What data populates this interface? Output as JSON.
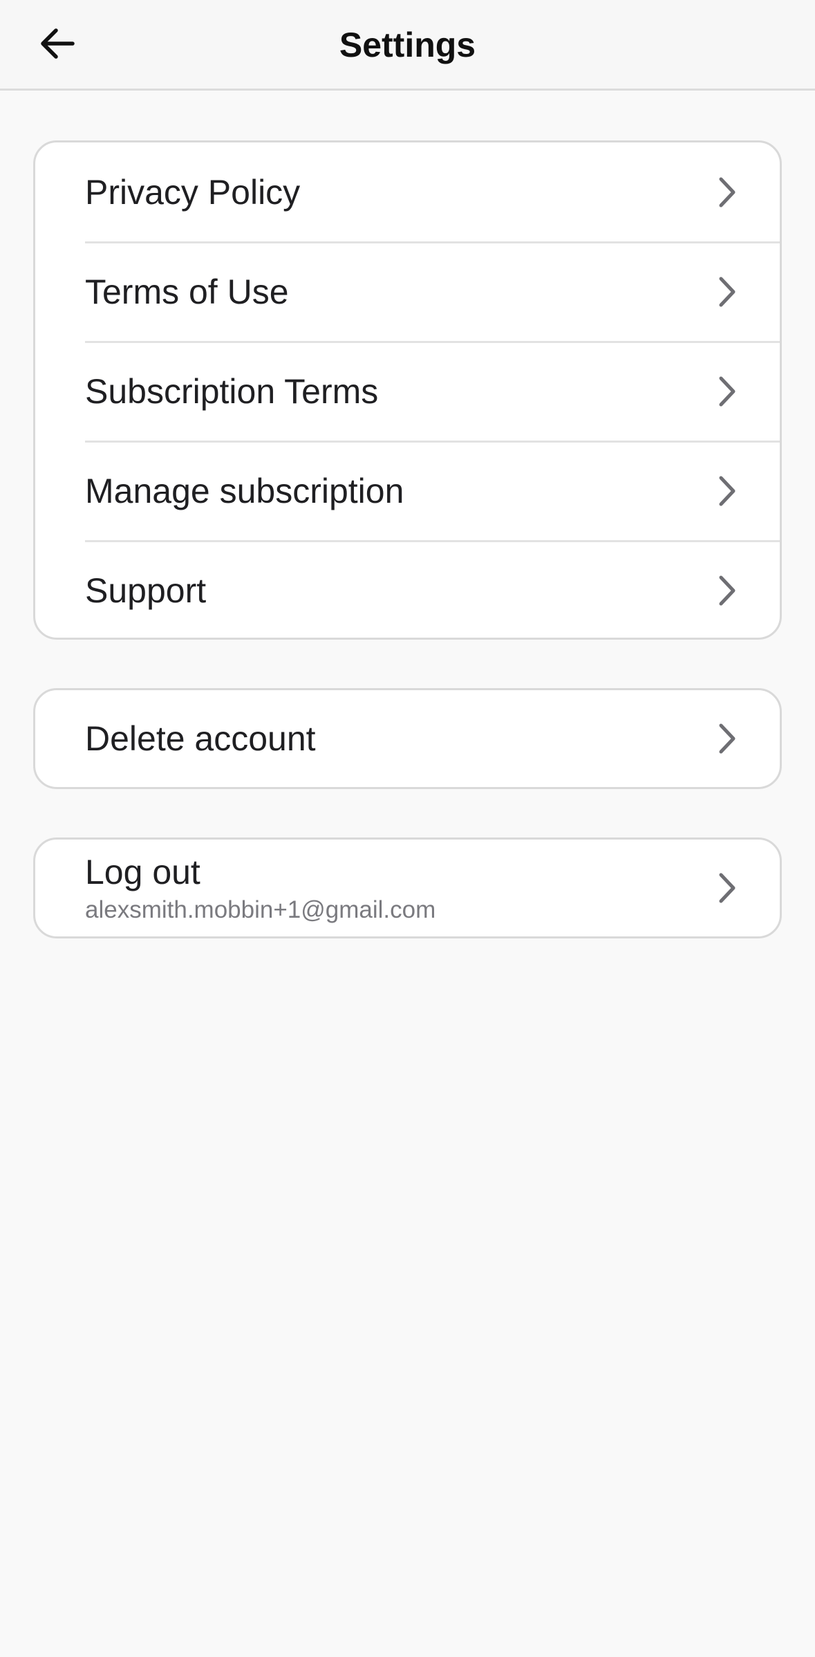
{
  "header": {
    "title": "Settings",
    "back_icon": "arrow-left-icon"
  },
  "menu": {
    "items": [
      {
        "label": "Privacy Policy",
        "icon": "chevron-right-icon"
      },
      {
        "label": "Terms of Use",
        "icon": "chevron-right-icon"
      },
      {
        "label": "Subscription Terms",
        "icon": "chevron-right-icon"
      },
      {
        "label": "Manage subscription",
        "icon": "chevron-right-icon"
      },
      {
        "label": "Support",
        "icon": "chevron-right-icon"
      }
    ]
  },
  "delete_account": {
    "label": "Delete account",
    "icon": "chevron-right-icon"
  },
  "logout": {
    "label": "Log out",
    "email": "alexsmith.mobbin+1@gmail.com",
    "icon": "chevron-right-icon"
  },
  "colors": {
    "background": "#f9f9f9",
    "card": "#ffffff",
    "border": "#d9d9d9",
    "chevron": "#6e6e73",
    "text": "#1f1f22",
    "secondary_text": "#7a7a7f"
  }
}
